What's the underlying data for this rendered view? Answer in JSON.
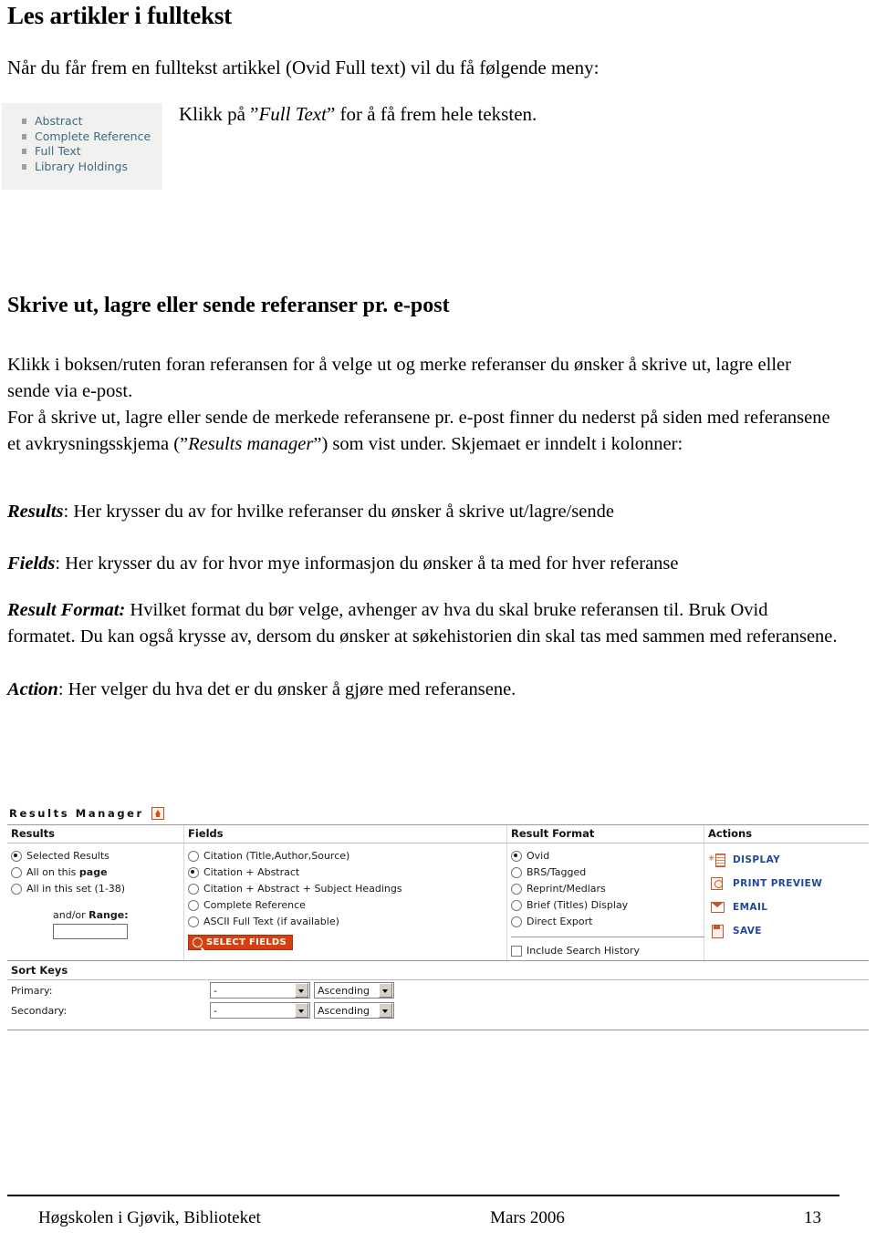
{
  "document": {
    "title": "Les artikler i fulltekst",
    "intro": "Når du får frem en fulltekst artikkel (Ovid Full text) vil du få følgende meny:",
    "callout_prefix": "Klikk på ”",
    "callout_italic": "Full Text",
    "callout_suffix": "” for å få frem hele teksten.",
    "section_title": "Skrive ut, lagre eller sende referanser pr. e-post",
    "paragraph_1_a": "Klikk i boksen/ruten foran referansen for å velge ut og merke referanser du ønsker å skrive ut, lagre eller sende via e-post.",
    "paragraph_1_b_pre": "For å skrive ut, lagre eller sende de merkede referansene pr. e-post finner du nederst på siden med referansene et avkrysningsskjema (”",
    "paragraph_1_b_italic": "Results manager",
    "paragraph_1_b_post": "”) som vist under. Skjemaet er inndelt i kolonner:",
    "results_lead": "Results",
    "results_text": ": Her krysser du av for hvilke referanser du ønsker å skrive ut/lagre/sende",
    "fields_lead": "Fields",
    "fields_text": ": Her krysser du av for hvor mye informasjon du ønsker å ta med for hver referanse",
    "result_format_lead": "Result  Format:",
    "result_format_text": " Hvilket format du bør velge, avhenger av hva du skal bruke referansen til. Bruk Ovid formatet. Du kan også krysse av, dersom du ønsker at søkehistorien din skal tas med sammen med referansene.",
    "action_lead": "Action",
    "action_text": ": Her velger du hva det er du ønsker å gjøre med referansene."
  },
  "ovid_menu": {
    "items": [
      {
        "label": "Abstract"
      },
      {
        "label": "Complete Reference"
      },
      {
        "label": "Full Text"
      },
      {
        "label": "Library Holdings"
      }
    ],
    "link_color": "#3d6b82",
    "background": "#f1f1ef"
  },
  "results_manager": {
    "title": "Results Manager",
    "columns": {
      "results": "Results",
      "fields": "Fields",
      "result_format": "Result Format",
      "actions": "Actions"
    },
    "results_options": [
      {
        "label": "Selected Results",
        "selected": true
      },
      {
        "label_pre": "All on this ",
        "label_bold": "page",
        "selected": false
      },
      {
        "label": "All in this set (1-38)",
        "selected": false
      }
    ],
    "range": {
      "label_pre": "and/or ",
      "label_bold": "Range:",
      "value": ""
    },
    "fields_options": [
      {
        "label": "Citation (Title,Author,Source)",
        "selected": false
      },
      {
        "label": "Citation + Abstract",
        "selected": true
      },
      {
        "label": "Citation + Abstract + Subject Headings",
        "selected": false
      },
      {
        "label": "Complete Reference",
        "selected": false
      },
      {
        "label": "ASCII Full Text (if available)",
        "selected": false
      }
    ],
    "select_fields_button": "SELECT FIELDS",
    "format_options": [
      {
        "label": "Ovid",
        "selected": true
      },
      {
        "label": "BRS/Tagged",
        "selected": false
      },
      {
        "label": "Reprint/Medlars",
        "selected": false
      },
      {
        "label": "Brief (Titles) Display",
        "selected": false
      },
      {
        "label": "Direct Export",
        "selected": false
      }
    ],
    "include_search_history": {
      "label": "Include Search History",
      "checked": false
    },
    "actions": [
      {
        "label": "DISPLAY",
        "icon": "display-icon"
      },
      {
        "label": "PRINT PREVIEW",
        "icon": "print-preview-icon"
      },
      {
        "label": "EMAIL",
        "icon": "email-icon"
      },
      {
        "label": "SAVE",
        "icon": "save-icon"
      }
    ],
    "sort_keys": {
      "title": "Sort Keys",
      "rows": [
        {
          "label": "Primary:",
          "field": "-",
          "order": "Ascending"
        },
        {
          "label": "Secondary:",
          "field": "-",
          "order": "Ascending"
        }
      ]
    },
    "accent_color": "#d6400f",
    "link_color": "#20499b"
  },
  "footer": {
    "left": "Høgskolen i Gjøvik, Biblioteket",
    "center": "Mars 2006",
    "page_number": "13"
  }
}
